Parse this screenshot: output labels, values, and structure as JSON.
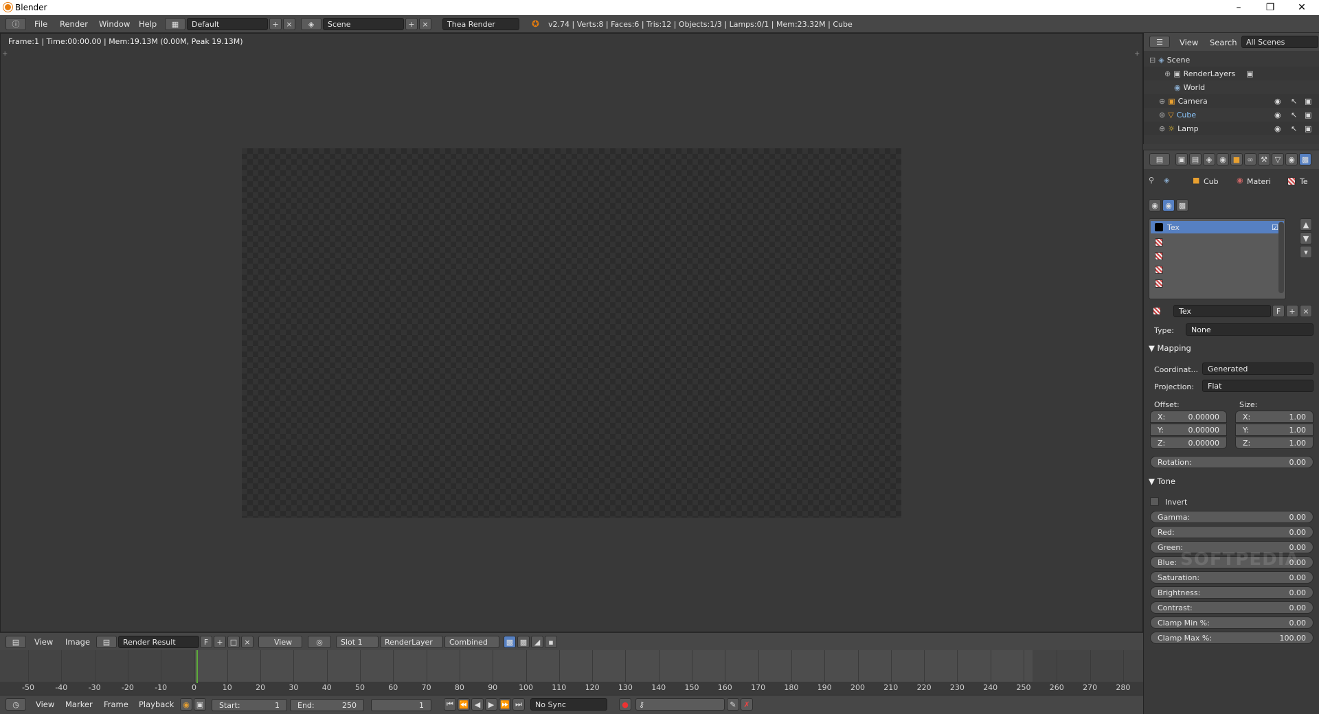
{
  "window": {
    "title": "Blender"
  },
  "menu": {
    "file": "File",
    "render": "Render",
    "window": "Window",
    "help": "Help"
  },
  "screen_layout": "Default",
  "scene": "Scene",
  "engine": "Thea Render",
  "stats": "v2.74 | Verts:8 | Faces:6 | Tris:12 | Objects:1/3 | Lamps:0/1 | Mem:23.32M | Cube",
  "editor": {
    "frame_info": "Frame:1 | Time:00:00.00 | Mem:19.13M (0.00M, Peak 19.13M)"
  },
  "image_header": {
    "view": "View",
    "image": "Image",
    "image_name": "Render Result",
    "f": "F",
    "view_dd": "View",
    "slot": "Slot 1",
    "layer": "RenderLayer",
    "pass": "Combined"
  },
  "timeline": {
    "labels": [
      "-50",
      "-40",
      "-30",
      "-20",
      "-10",
      "0",
      "10",
      "20",
      "30",
      "40",
      "50",
      "60",
      "70",
      "80",
      "90",
      "100",
      "110",
      "120",
      "130",
      "140",
      "150",
      "160",
      "170",
      "180",
      "190",
      "200",
      "210",
      "220",
      "230",
      "240",
      "250",
      "260",
      "270",
      "280"
    ],
    "current_frame": 1
  },
  "timeline_header": {
    "view": "View",
    "marker": "Marker",
    "frame": "Frame",
    "playback": "Playback",
    "start_label": "Start:",
    "start": "1",
    "end_label": "End:",
    "end": "250",
    "current": "1",
    "sync": "No Sync"
  },
  "outliner": {
    "view": "View",
    "search": "Search",
    "filter": "All Scenes",
    "items": [
      {
        "label": "Scene"
      },
      {
        "label": "RenderLayers"
      },
      {
        "label": "World"
      },
      {
        "label": "Camera"
      },
      {
        "label": "Cube"
      },
      {
        "label": "Lamp"
      }
    ]
  },
  "properties": {
    "breadcrumb": {
      "object": "Cub",
      "material": "Materi",
      "texture": "Te"
    },
    "tex_slot": "Tex",
    "tex_name": "Tex",
    "tex_f": "F",
    "type_label": "Type:",
    "type_value": "None",
    "mapping": {
      "title": "Mapping",
      "coord_label": "Coordinat...",
      "coord_value": "Generated",
      "proj_label": "Projection:",
      "proj_value": "Flat",
      "offset_label": "Offset:",
      "size_label": "Size:",
      "offset": {
        "x_label": "X:",
        "x": "0.00000",
        "y_label": "Y:",
        "y": "0.00000",
        "z_label": "Z:",
        "z": "0.00000"
      },
      "size": {
        "x_label": "X:",
        "x": "1.00",
        "y_label": "Y:",
        "y": "1.00",
        "z_label": "Z:",
        "z": "1.00"
      },
      "rotation_label": "Rotation:",
      "rotation": "0.00"
    },
    "tone": {
      "title": "Tone",
      "invert": "Invert",
      "fields": [
        {
          "label": "Gamma:",
          "value": "0.00"
        },
        {
          "label": "Red:",
          "value": "0.00"
        },
        {
          "label": "Green:",
          "value": "0.00"
        },
        {
          "label": "Blue:",
          "value": "0.00"
        },
        {
          "label": "Saturation:",
          "value": "0.00"
        },
        {
          "label": "Brightness:",
          "value": "0.00"
        },
        {
          "label": "Contrast:",
          "value": "0.00"
        },
        {
          "label": "Clamp Min %:",
          "value": "0.00"
        },
        {
          "label": "Clamp Max %:",
          "value": "100.00"
        }
      ]
    }
  },
  "watermark": "SOFTPEDIA"
}
